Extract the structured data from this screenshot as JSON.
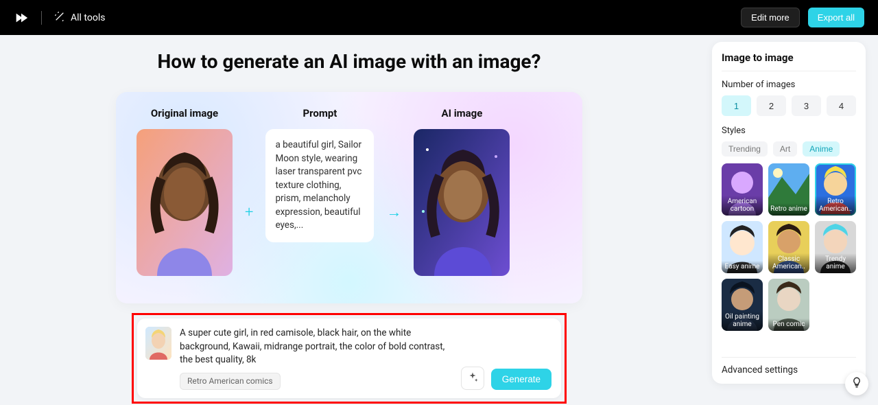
{
  "topbar": {
    "all_tools_label": "All tools",
    "edit_more_label": "Edit more",
    "export_all_label": "Export all"
  },
  "page_title": "How to generate an AI image with an image?",
  "hero": {
    "original_label": "Original image",
    "prompt_label": "Prompt",
    "ai_label": "AI image",
    "prompt_text": "a beautiful girl, Sailor Moon style, wearing laser transparent pvc texture clothing, prism, melancholy expression, beautiful eyes,..."
  },
  "input": {
    "text": "A super cute girl, in red camisole, black hair, on the white background, Kawaii, midrange portrait,  the color of bold contrast, the best quality, 8k",
    "style_tag": "Retro American comics",
    "generate_label": "Generate"
  },
  "panel": {
    "title": "Image to image",
    "num_label": "Number of images",
    "num_options": [
      "1",
      "2",
      "3",
      "4"
    ],
    "num_selected_index": 0,
    "styles_label": "Styles",
    "style_tabs": [
      "Trending",
      "Art",
      "Anime"
    ],
    "style_tab_selected_index": 2,
    "style_cards": [
      {
        "name": "American cartoon"
      },
      {
        "name": "Retro anime"
      },
      {
        "name": "Retro American.."
      },
      {
        "name": "Easy anime"
      },
      {
        "name": "Classic American.."
      },
      {
        "name": "Trendy anime"
      },
      {
        "name": "Oil painting anime"
      },
      {
        "name": "Pen comic"
      }
    ],
    "style_selected_index": 2,
    "advanced_label": "Advanced settings"
  }
}
